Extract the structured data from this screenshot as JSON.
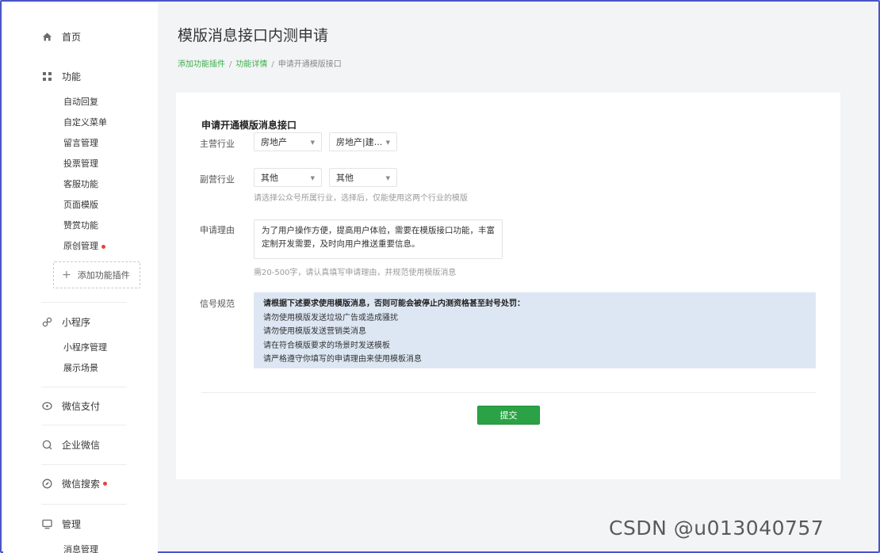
{
  "sidebar": {
    "home": "首页",
    "features": {
      "label": "功能",
      "items": [
        "自动回复",
        "自定义菜单",
        "留言管理",
        "投票管理",
        "客服功能",
        "页面模版",
        "赞赏功能",
        "原创管理"
      ],
      "add_plugin": "添加功能插件"
    },
    "miniprogram": {
      "label": "小程序",
      "items": [
        "小程序管理",
        "展示场景"
      ]
    },
    "wechat_pay": "微信支付",
    "work_wechat": "企业微信",
    "wechat_search": "微信搜索",
    "manage": {
      "label": "管理",
      "items": [
        "消息管理"
      ]
    }
  },
  "main": {
    "title": "模版消息接口内测申请",
    "breadcrumb": {
      "crumb1": "添加功能插件",
      "crumb2": "功能详情",
      "crumb3": "申请开通模版接口"
    },
    "form": {
      "section_title": "申请开通模版消息接口",
      "primary_industry": {
        "label": "主营行业",
        "select1": "房地产",
        "select2": "房地产|建..."
      },
      "secondary_industry": {
        "label": "副营行业",
        "select1": "其他",
        "select2": "其他",
        "hint": "请选择公众号所属行业，选择后，仅能使用这两个行业的模版"
      },
      "reason": {
        "label": "申请理由",
        "value": "为了用户操作方便，提高用户体验，需要在模版接口功能，丰富定制开发需要，及时向用户推送重要信息。",
        "hint": "需20-500字，请认真填写申请理由，并规范使用模版消息"
      },
      "norms": {
        "label": "信号规范",
        "heading": "请根据下述要求使用模版消息，否则可能会被停止内测资格甚至封号处罚：",
        "lines": [
          "请勿使用模版发送垃圾广告或造成骚扰",
          "请勿使用模版发送营销类消息",
          "请在符合模版要求的场景时发送模板",
          "请严格遵守你填写的申请理由来使用模板消息"
        ]
      },
      "submit_label": "提交"
    }
  },
  "watermark": "CSDN @u013040757",
  "colors": {
    "accent_green": "#2ba245",
    "link_green": "#3bb04a",
    "notice_bg": "#dde7f4",
    "red_dot": "#e64340"
  }
}
